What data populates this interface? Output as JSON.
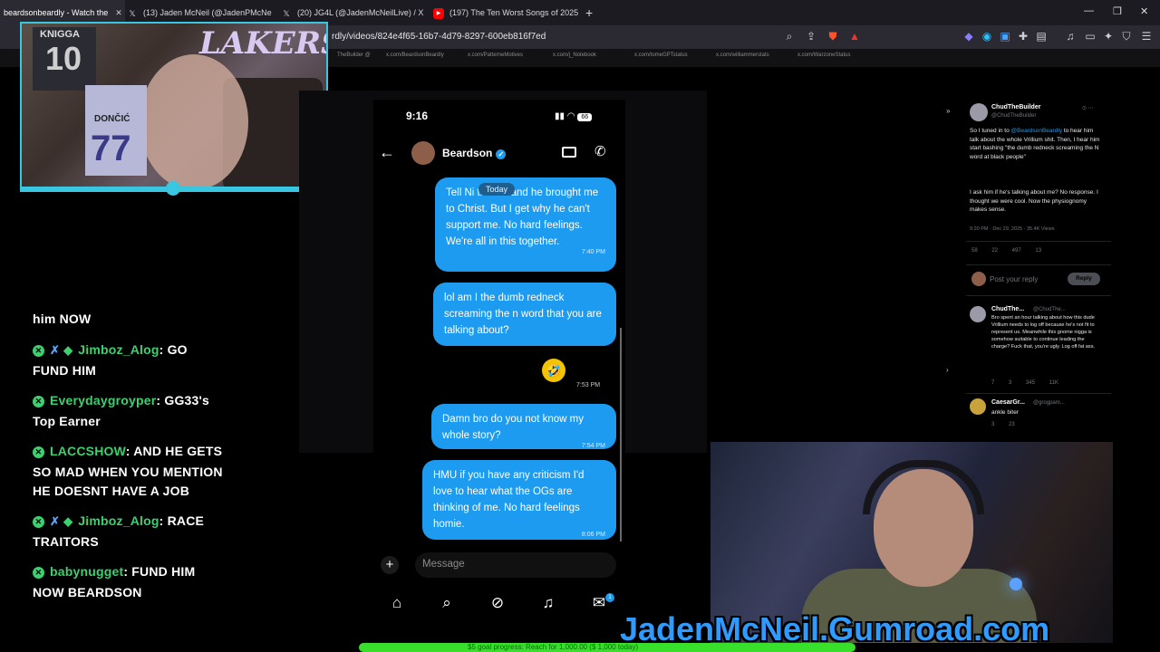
{
  "browser": {
    "tabs": [
      {
        "label": "beardsonbeardly - Watch the",
        "icon": "page-icon",
        "active": true
      },
      {
        "label": "(13) Jaden McNeil (@JadenPMcNeil",
        "icon": "x-logo-icon"
      },
      {
        "label": "(20) JG4L (@JadenMcNeilLive) / X",
        "icon": "x-logo-icon"
      },
      {
        "label": "(197) The Ten Worst Songs of 2025",
        "icon": "youtube-icon"
      }
    ],
    "url": "rdly/videos/824e4f65-16b7-4d79-8297-600eb816f7ed",
    "bookmarks": [
      "TheBuilder @",
      "x.com/BeardsonBeardly",
      "x.com/PatterneMotives",
      "x.com/j_Notebook",
      "x.com/tomeGPTstatus",
      "x.com/williammerstats",
      "x.com/WarzoneStatus"
    ]
  },
  "stream_chat": {
    "partial_top": "him NOW",
    "messages": [
      {
        "user": "Jimboz_Alog",
        "text_1": "GO",
        "text_2": "FUND HIM",
        "extra_badges": true
      },
      {
        "user": "Everydaygroyper",
        "text_1": "GG33's",
        "text_2": "Top Earner",
        "extra_badges": false
      },
      {
        "user": "LACCSHOW",
        "text_1": "AND HE GETS",
        "text_2": "SO MAD WHEN YOU MENTION",
        "text_3": "HE DOESNT HAVE A JOB",
        "extra_badges": false
      },
      {
        "user": "Jimboz_Alog",
        "text_1": "RACE",
        "text_2": "TRAITORS",
        "extra_badges": true
      },
      {
        "user": "babynugget",
        "text_1": "FUND HIM",
        "text_2": "NOW BEARDSON",
        "extra_badges": false
      }
    ]
  },
  "webcam_top": {
    "lakers": "LAKERS",
    "jersey_name": "KNIGGA",
    "jersey_num": "10",
    "jersey2_name": "DONČIĆ",
    "jersey2_num": "77"
  },
  "phone": {
    "time": "9:16",
    "battery": "66",
    "contact_name": "Beardson",
    "today_label": "Today",
    "messages": [
      {
        "text": "Tell Ni the kid and he brought me to Christ. But I get why he can't support me. No hard feelings. We're all in this together.",
        "time": "7:40 PM"
      },
      {
        "text": "lol am I the dumb redneck screaming the n word that you are talking about?",
        "time": ""
      },
      {
        "text": "Damn bro do you not know my whole story?",
        "time": "7:54 PM"
      },
      {
        "text": "HMU if you have any criticism I'd love to hear what the OGs are thinking of me. No hard feelings homie.",
        "time": "8:06 PM"
      }
    ],
    "emoji": "🤣",
    "emoji_time": "7:53 PM",
    "message_placeholder": "Message",
    "nav": [
      "home-icon",
      "search-icon",
      "grok-icon",
      "bell-icon",
      "mail-icon"
    ],
    "notif_count": "1"
  },
  "x_panel": {
    "post": {
      "name": "ChudTheBuilder",
      "handle": "@ChudTheBuilder",
      "text_a": "So I tuned in to ",
      "mention": "@BeardsonBeardly",
      "text_b": " to hear him talk about the whole Vrillium shit. Then, I hear him start bashing \"the dumb redneck screaming the N word at black people\"",
      "text_c": "I ask him if he's talking about me? No response. I thought we were cool. Now the physiognomy makes sense.",
      "meta": "9:20 PM · Dec 29, 2025 · 35.4K Views",
      "actions": "58 22 497 13"
    },
    "reply_placeholder": "Post your reply",
    "reply_button": "Reply",
    "reply1": {
      "name": "ChudThe...",
      "handle": "@ChudThe...",
      "text": "Bro spent an hour talking about how this dude Vrillium needs to log off because he's not fit to represent us. Meanwhile this gnome nigga is somehow suitable to continue leading the charge? Fuck that, you're ugly. Log off fat ass.",
      "actions": "7 3 345 11K"
    },
    "reply2": {
      "name": "CaesarGr...",
      "handle": "@grogpam...",
      "text": "ankle biter",
      "actions": "3 23"
    }
  },
  "overlay": {
    "gumroad": "JadenMcNeil.Gumroad.com",
    "ticker": "$5 goal progress: Reach for 1,000.00 ($ 1,000 today)"
  }
}
